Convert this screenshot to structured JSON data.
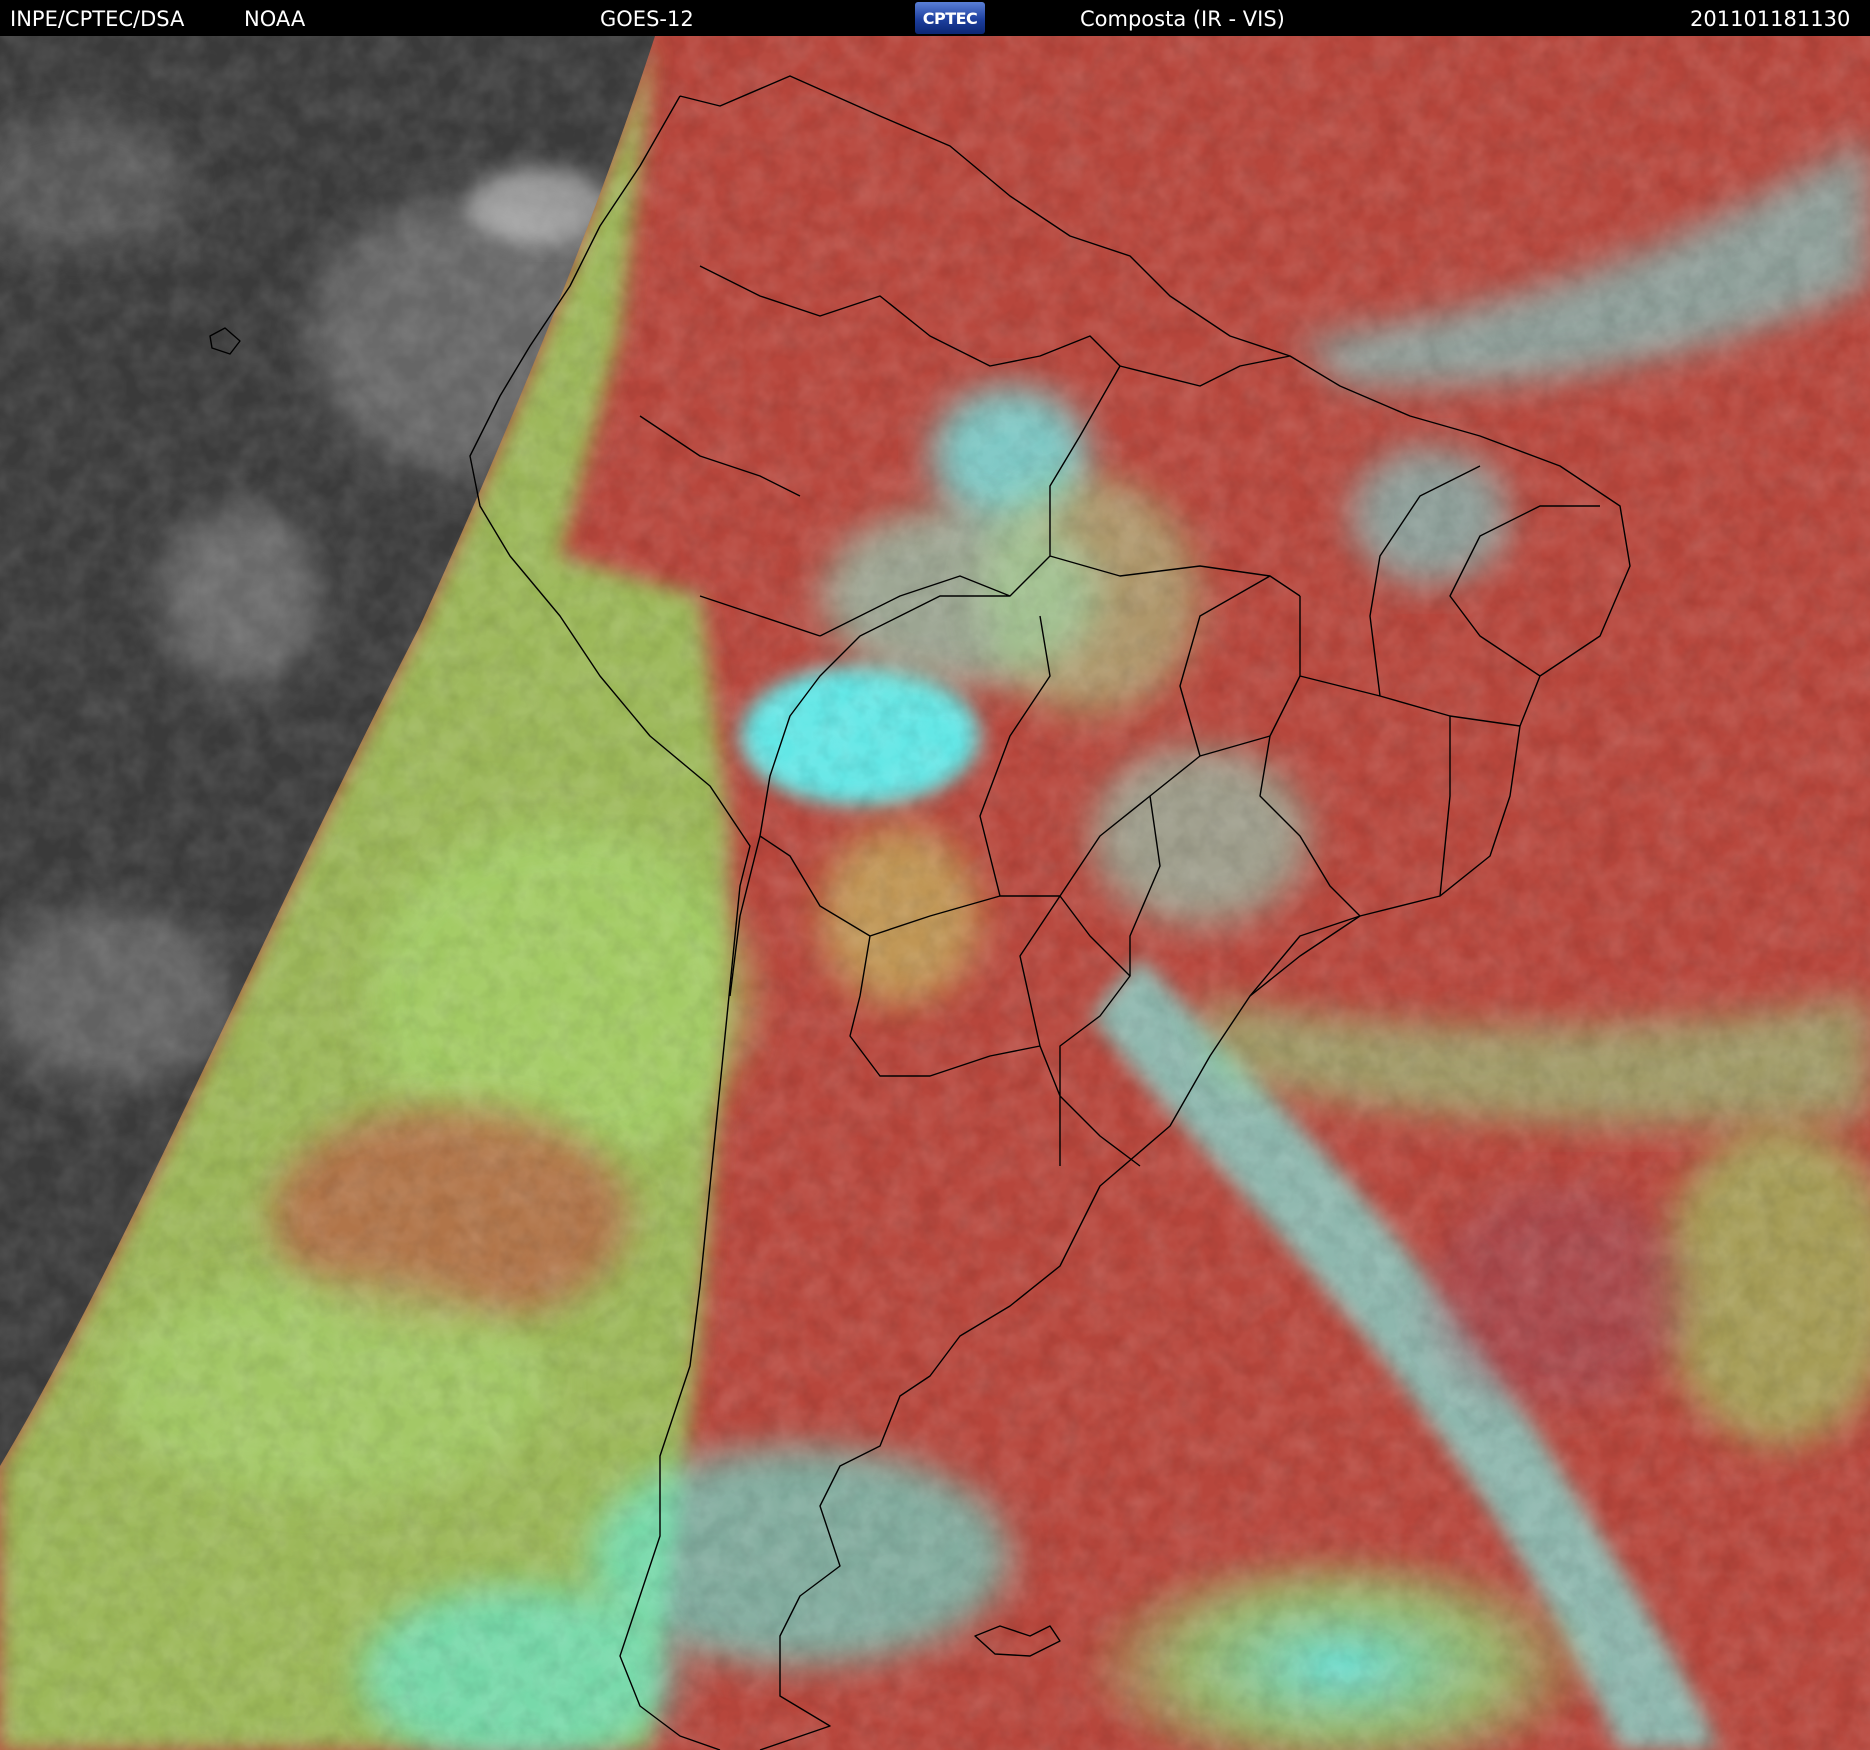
{
  "header": {
    "institution": "INPE/CPTEC/DSA",
    "agency": "NOAA",
    "satellite": "GOES-12",
    "logo_text": "CPTEC",
    "product": "Composta (IR - VIS)",
    "timestamp": "201101181130"
  },
  "colors": {
    "night_gray": "#3a3a3a",
    "clear_ocean_red": "#b7463c",
    "low_cloud_green": "#9acf60",
    "high_cloud_cyan": "#5ff0e8",
    "outline": "#000000"
  },
  "map": {
    "region": "South America",
    "content": "satellite composite imagery with political boundaries"
  }
}
